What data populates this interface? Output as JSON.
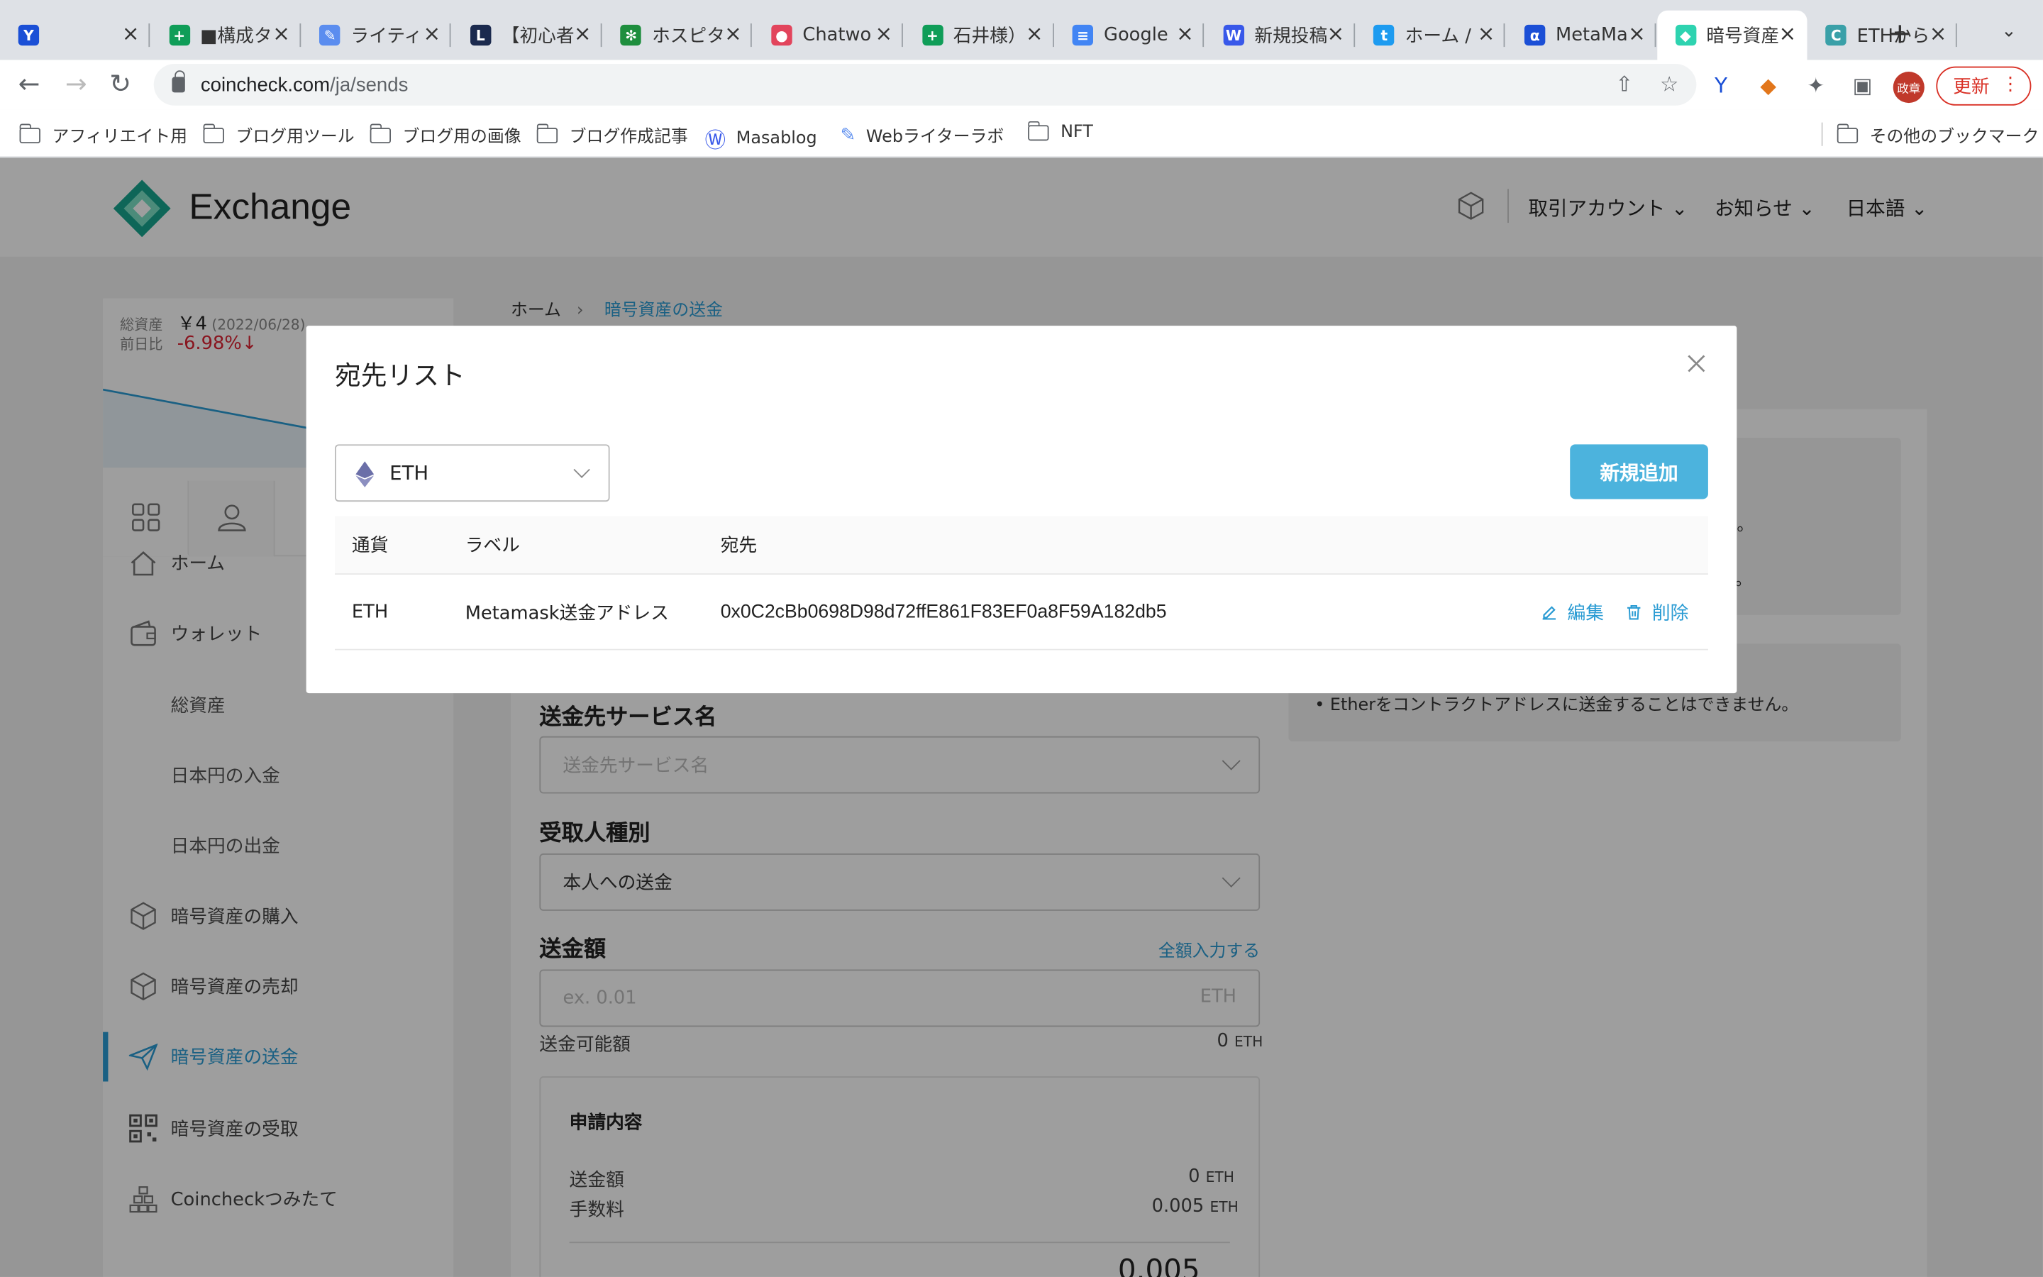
{
  "browser": {
    "tabs": [
      {
        "title": "",
        "color": "#1a4fd6",
        "glyph": "Y"
      },
      {
        "title": "■構成タ",
        "color": "#0f9d58",
        "glyph": "+"
      },
      {
        "title": "ライティ",
        "color": "#5b8def",
        "glyph": "✎"
      },
      {
        "title": "【初心者",
        "color": "#1b2a4e",
        "glyph": "L"
      },
      {
        "title": "ホスピタ",
        "color": "#1e8e3e",
        "glyph": "✻"
      },
      {
        "title": "Chatwo",
        "color": "#e2445c",
        "glyph": "●"
      },
      {
        "title": "石井様）",
        "color": "#0f9d58",
        "glyph": "+"
      },
      {
        "title": "Google",
        "color": "#4285f4",
        "glyph": "≡"
      },
      {
        "title": "新規投稿",
        "color": "#3858e9",
        "glyph": "W"
      },
      {
        "title": "ホーム /",
        "color": "#1d9bf0",
        "glyph": "t"
      },
      {
        "title": "MetaMa",
        "color": "#1b4fd6",
        "glyph": "α"
      },
      {
        "title": "暗号資産",
        "color": "#2ed3b0",
        "glyph": "◆",
        "active": true
      },
      {
        "title": "ETHから",
        "color": "#3aa0a8",
        "glyph": "C"
      }
    ],
    "url_host": "coincheck.com",
    "url_path": "/ja/sends",
    "profile_label": "政章",
    "update_label": "更新",
    "bookmarks": [
      {
        "label": "アフィリエイト用",
        "icon": "folder-icon"
      },
      {
        "label": "ブログ用ツール",
        "icon": "folder-icon"
      },
      {
        "label": "ブログ用の画像",
        "icon": "folder-icon"
      },
      {
        "label": "ブログ作成記事",
        "icon": "folder-icon"
      },
      {
        "label": "Masablog",
        "icon": "wordpress-icon"
      },
      {
        "label": "Webライターラボ",
        "icon": "pen-icon"
      },
      {
        "label": "NFT",
        "icon": "folder-icon"
      }
    ],
    "other_bookmarks": "その他のブックマーク"
  },
  "header": {
    "logo": "Exchange",
    "nav": {
      "account": "取引アカウント",
      "news": "お知らせ",
      "language": "日本語"
    }
  },
  "sidebar": {
    "total_label": "総資産",
    "total_value": "￥4",
    "total_date": "(2022/06/28)",
    "change_label": "前日比",
    "change_value": "-6.98%↓",
    "menu": [
      {
        "label": "ホーム",
        "icon": "home-icon"
      },
      {
        "label": "ウォレット",
        "icon": "wallet-icon"
      },
      {
        "label": "総資産",
        "sub": true
      },
      {
        "label": "日本円の入金",
        "sub": true
      },
      {
        "label": "日本円の出金",
        "sub": true
      },
      {
        "label": "暗号資産の購入",
        "icon": "cube-icon"
      },
      {
        "label": "暗号資産の売却",
        "icon": "cube-icon"
      },
      {
        "label": "暗号資産の送金",
        "icon": "send-icon",
        "active": true
      },
      {
        "label": "暗号資産の受取",
        "icon": "qr-icon"
      },
      {
        "label": "Coincheckつみたて",
        "icon": "stack-icon"
      }
    ]
  },
  "breadcrumb": {
    "home": "ホーム",
    "current": "暗号資産の送金"
  },
  "form": {
    "service_label": "送金先サービス名",
    "service_placeholder": "送金先サービス名",
    "recipient_label": "受取人種別",
    "recipient_value": "本人への送金",
    "amount_label": "送金額",
    "fill_all": "全額入力する",
    "amount_placeholder": "ex. 0.01",
    "amount_unit": "ETH",
    "available_label": "送金可能額",
    "available_value": "0",
    "available_unit": "ETH",
    "summary_title": "申請内容",
    "summary_amount_label": "送金額",
    "summary_amount_value": "0",
    "summary_fee_label": "手数料",
    "summary_fee_value": "0.005",
    "summary_unit": "ETH",
    "summary_total_partial": "0.005"
  },
  "notes": {
    "line1": "せん。",
    "line2": "ます。",
    "line3": "Etherをコントラクトアドレスに送金することはできません。"
  },
  "modal": {
    "title": "宛先リスト",
    "currency_select": "ETH",
    "add_button": "新規追加",
    "columns": {
      "currency": "通貨",
      "label": "ラベル",
      "address": "宛先"
    },
    "rows": [
      {
        "currency": "ETH",
        "label": "Metamask送金アドレス",
        "address": "0x0C2cBb0698D98d72ffE861F83EF0a8F59A182db5",
        "edit": "編集",
        "delete": "削除"
      }
    ]
  },
  "colors": {
    "accent": "#2a9bd3",
    "button": "#4cb3dd",
    "negative": "#dd2233"
  }
}
